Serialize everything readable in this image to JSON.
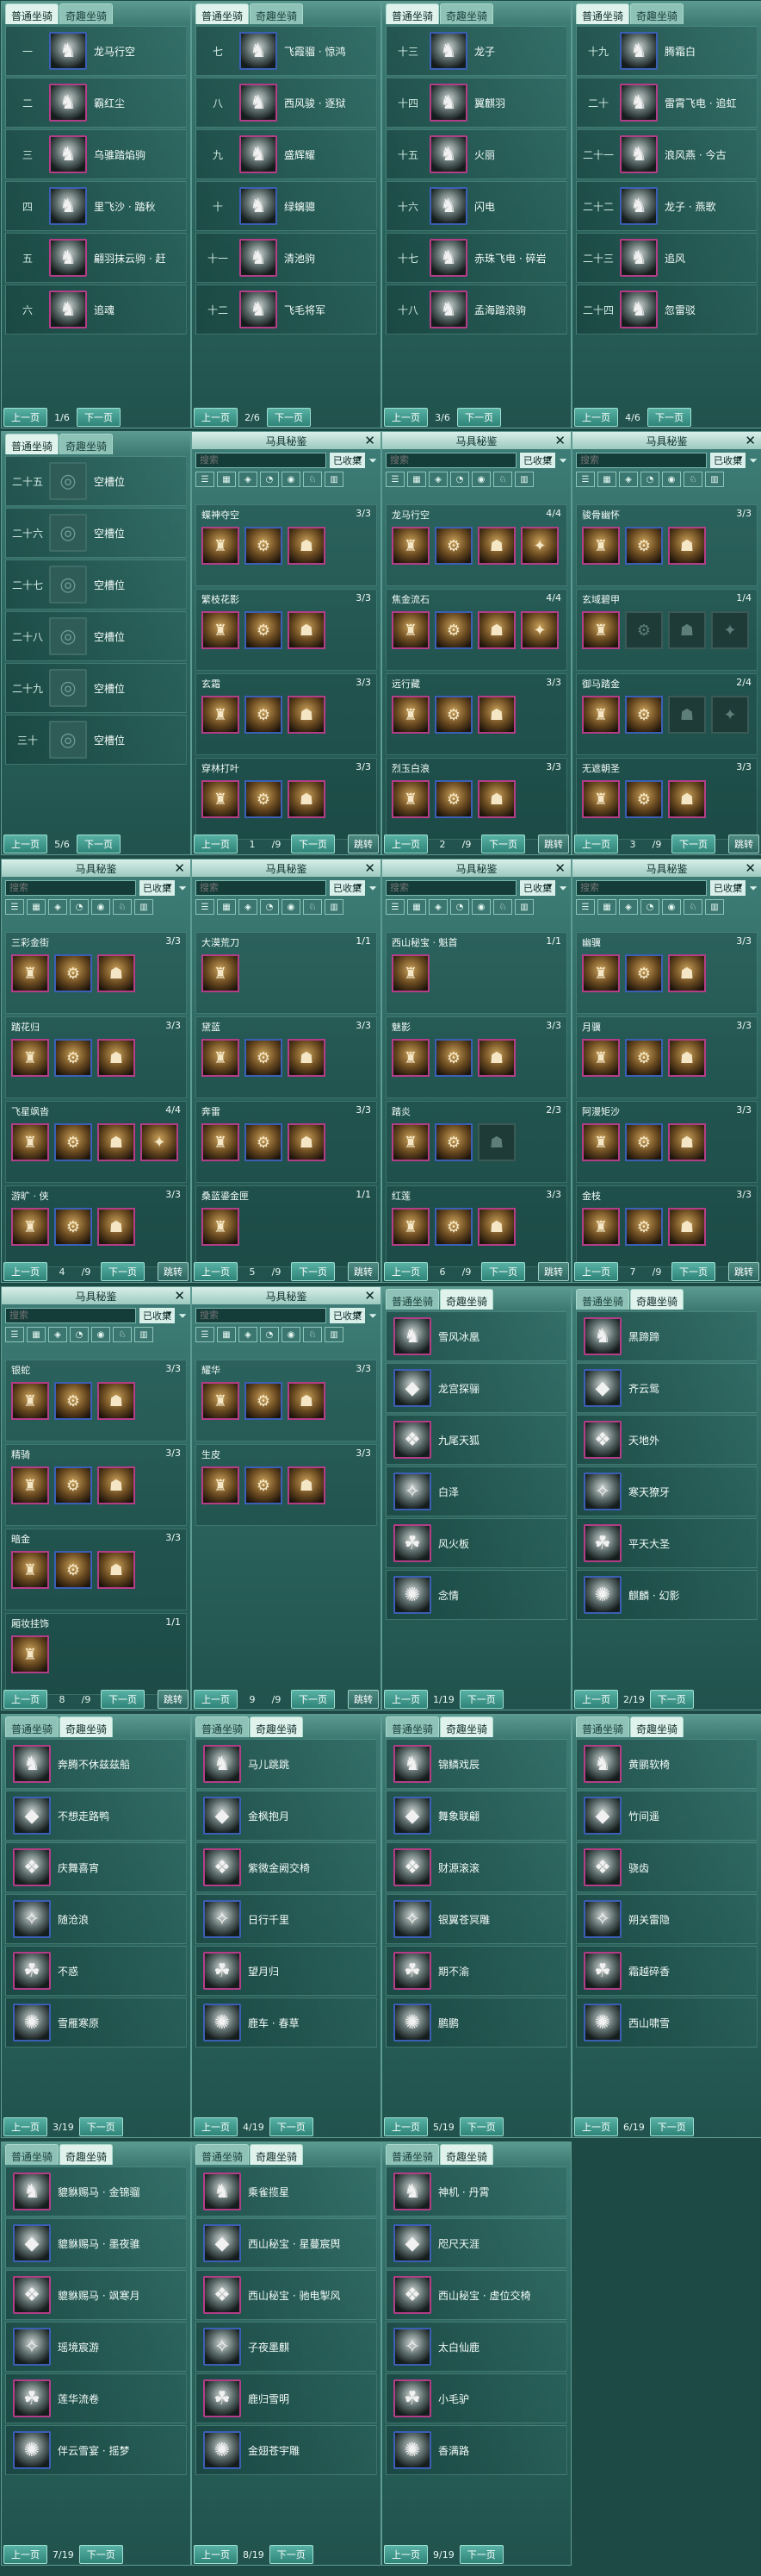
{
  "tabs": {
    "normal": "普通坐骑",
    "special": "奇趣坐骑"
  },
  "btn": {
    "prev": "上一页",
    "next": "下一页",
    "jump": "跳转"
  },
  "lbl": {
    "title": "马具秘鉴",
    "search": "搜索",
    "collected": "已收集"
  },
  "normal": [
    {
      "page": "1/6",
      "rows": [
        {
          "i": "一",
          "n": "龙马行空"
        },
        {
          "i": "二",
          "n": "霸红尘"
        },
        {
          "i": "三",
          "n": "乌骓踏焰驹"
        },
        {
          "i": "四",
          "n": "里飞沙 · 踏秋"
        },
        {
          "i": "五",
          "n": "翩羽抹云驹 · 赶"
        },
        {
          "i": "六",
          "n": "追魂"
        }
      ]
    },
    {
      "page": "2/6",
      "rows": [
        {
          "i": "七",
          "n": "飞霞骝 · 惊鸿"
        },
        {
          "i": "八",
          "n": "西风骏 · 逐狱"
        },
        {
          "i": "九",
          "n": "盛辉耀"
        },
        {
          "i": "十",
          "n": "绿螭骢"
        },
        {
          "i": "十一",
          "n": "清池驹"
        },
        {
          "i": "十二",
          "n": "飞毛将军"
        }
      ]
    },
    {
      "page": "3/6",
      "rows": [
        {
          "i": "十三",
          "n": "龙子"
        },
        {
          "i": "十四",
          "n": "翼麒羽"
        },
        {
          "i": "十五",
          "n": "火丽"
        },
        {
          "i": "十六",
          "n": "闪电"
        },
        {
          "i": "十七",
          "n": "赤珠飞电 · 碎岩"
        },
        {
          "i": "十八",
          "n": "孟海踏浪驹"
        }
      ]
    },
    {
      "page": "4/6",
      "rows": [
        {
          "i": "十九",
          "n": "腾霜白"
        },
        {
          "i": "二十",
          "n": "雷霄飞电 · 追虹"
        },
        {
          "i": "二十一",
          "n": "浪风燕 · 今古"
        },
        {
          "i": "二十二",
          "n": "龙子 · 燕歌"
        },
        {
          "i": "二十三",
          "n": "追风"
        },
        {
          "i": "二十四",
          "n": "忽雷驳"
        }
      ]
    },
    {
      "page": "5/6",
      "rows": [
        {
          "i": "二十五",
          "n": "空槽位"
        },
        {
          "i": "二十六",
          "n": "空槽位"
        },
        {
          "i": "二十七",
          "n": "空槽位"
        },
        {
          "i": "二十八",
          "n": "空槽位"
        },
        {
          "i": "二十九",
          "n": "空槽位"
        },
        {
          "i": "三十",
          "n": "空槽位"
        }
      ]
    }
  ],
  "sets": [
    {
      "page": "1",
      "total": "/9",
      "items": [
        {
          "n": "蝶神夺空",
          "c": "3/3"
        },
        {
          "n": "繁枝花影",
          "c": "3/3"
        },
        {
          "n": "玄霜",
          "c": "3/3"
        },
        {
          "n": "穿林打叶",
          "c": "3/3"
        }
      ]
    },
    {
      "page": "2",
      "total": "/9",
      "items": [
        {
          "n": "龙马行空",
          "c": "4/4"
        },
        {
          "n": "焦金流石",
          "c": "4/4"
        },
        {
          "n": "远行藏",
          "c": "3/3"
        },
        {
          "n": "烈玉白浪",
          "c": "3/3"
        }
      ]
    },
    {
      "page": "3",
      "total": "/9",
      "items": [
        {
          "n": "骏骨幽怀",
          "c": "3/3"
        },
        {
          "n": "玄域碧甲",
          "c": "1/4"
        },
        {
          "n": "御马踏金",
          "c": "2/4"
        },
        {
          "n": "无遮朝圣",
          "c": "3/3"
        }
      ]
    },
    {
      "page": "4",
      "total": "/9",
      "items": [
        {
          "n": "三彩金街",
          "c": "3/3"
        },
        {
          "n": "踏花归",
          "c": "3/3"
        },
        {
          "n": "飞星飒沓",
          "c": "4/4"
        },
        {
          "n": "游旷 · 侠",
          "c": "3/3"
        }
      ]
    },
    {
      "page": "5",
      "total": "/9",
      "items": [
        {
          "n": "大漠荒刀",
          "c": "1/1"
        },
        {
          "n": "黛蓝",
          "c": "3/3"
        },
        {
          "n": "奔雷",
          "c": "3/3"
        },
        {
          "n": "桑蓝鎏金匣",
          "c": "1/1"
        }
      ]
    },
    {
      "page": "6",
      "total": "/9",
      "items": [
        {
          "n": "西山秘宝 · 魁首",
          "c": "1/1"
        },
        {
          "n": "魅影",
          "c": "3/3"
        },
        {
          "n": "踏炎",
          "c": "2/3"
        },
        {
          "n": "红莲",
          "c": "3/3"
        }
      ]
    },
    {
      "page": "7",
      "total": "/9",
      "items": [
        {
          "n": "幽骥",
          "c": "3/3"
        },
        {
          "n": "月骥",
          "c": "3/3"
        },
        {
          "n": "阿漫矩沙",
          "c": "3/3"
        },
        {
          "n": "金枝",
          "c": "3/3"
        }
      ]
    },
    {
      "page": "8",
      "total": "/9",
      "items": [
        {
          "n": "银蛇",
          "c": "3/3"
        },
        {
          "n": "精骑",
          "c": "3/3"
        },
        {
          "n": "暗金",
          "c": "3/3"
        },
        {
          "n": "厢妆挂饰",
          "c": "1/1"
        }
      ]
    },
    {
      "page": "9",
      "total": "/9",
      "items": [
        {
          "n": "耀华",
          "c": "3/3"
        },
        {
          "n": "生皮",
          "c": "3/3"
        }
      ]
    }
  ],
  "special": [
    {
      "page": "1/19",
      "rows": [
        "雪风冰凰",
        "龙宫探骊",
        "九尾天狐",
        "白泽",
        "风火板",
        "念情"
      ]
    },
    {
      "page": "2/19",
      "rows": [
        "黑蹄蹄",
        "齐云鸳",
        "天地外",
        "寒天獠牙",
        "平天大圣",
        "麒麟 · 幻影"
      ]
    },
    {
      "page": "3/19",
      "rows": [
        "奔腾不休兹兹船",
        "不想走路鸭",
        "庆舞喜宵",
        "随沧浪",
        "不惑",
        "雪雁寒原"
      ]
    },
    {
      "page": "4/19",
      "rows": [
        "马儿跳跳",
        "金枫抱月",
        "紫微金阙交椅",
        "日行千里",
        "望月归",
        "鹿车 · 春草"
      ]
    },
    {
      "page": "5/19",
      "rows": [
        "锦鳞戏辰",
        "舞象联翩",
        "财源滚滚",
        "银翼苍冥雕",
        "期不渝",
        "鹏鹏"
      ]
    },
    {
      "page": "6/19",
      "rows": [
        "黄鹂软椅",
        "竹间遥",
        "骁齿",
        "朔关雷隐",
        "霜越碎香",
        "西山啸雪"
      ]
    },
    {
      "page": "7/19",
      "rows": [
        "貔貅赐马 · 金锦骝",
        "貔貅赐马 · 墨夜骓",
        "貔貅赐马 · 飒寒月",
        "瑶境宸游",
        "莲华流卷",
        "伴云雪宴 · 摇梦"
      ]
    },
    {
      "page": "8/19",
      "rows": [
        "乘雀揽星",
        "西山秘宝 · 星蔓宸舆",
        "西山秘宝 · 驰电掣风",
        "子夜墨麒",
        "鹿归雪明",
        "金翅苍宇雕"
      ]
    },
    {
      "page": "9/19",
      "rows": [
        "神机 · 丹霄",
        "咫尺天涯",
        "西山秘宝 · 虚位交椅",
        "太白仙鹿",
        "小毛驴",
        "香满路"
      ]
    }
  ]
}
